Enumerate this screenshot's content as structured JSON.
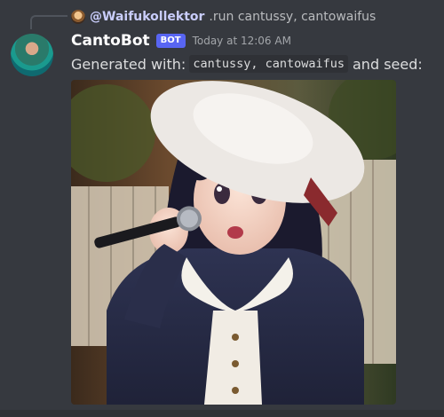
{
  "reply": {
    "mention": "@Waifukollektor",
    "text": ".run cantussy, cantowaifus"
  },
  "message": {
    "author": "CantoBot",
    "badge": "BOT",
    "timestamp": "Today at 12:06 AM",
    "text_before": "Generated with:",
    "code": "cantussy, cantowaifus",
    "text_after": "and seed:"
  },
  "attachment": {
    "icon": "generated-anime-image"
  },
  "colors": {
    "background": "#36393f",
    "mention": "#c9cdfb",
    "badge": "#5865f2",
    "username": "#ffffff"
  }
}
